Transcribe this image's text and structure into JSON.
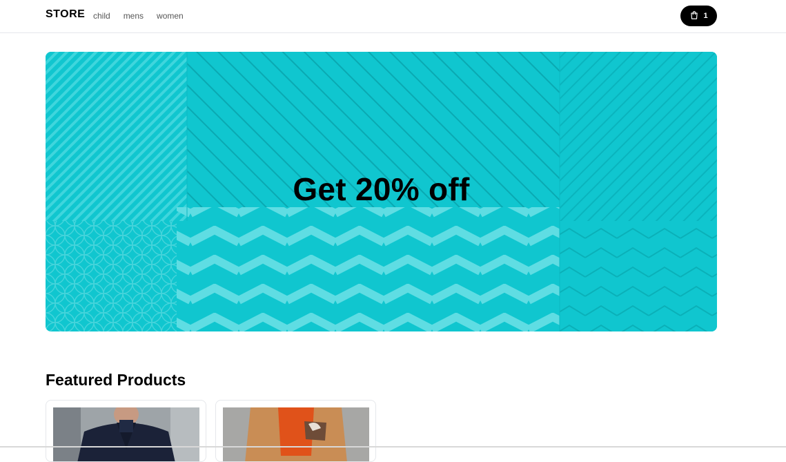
{
  "navbar": {
    "logo": "STORE",
    "links": [
      {
        "label": "child"
      },
      {
        "label": "mens"
      },
      {
        "label": "women"
      }
    ],
    "cart": {
      "icon": "shopping-bag-icon",
      "count": "1"
    }
  },
  "hero": {
    "title": "Get 20% off",
    "background_color": "#10c6cf"
  },
  "featured": {
    "title": "Featured Products",
    "products": [
      {
        "image": "man in navy coat"
      },
      {
        "image": "man in camel coat"
      }
    ]
  }
}
